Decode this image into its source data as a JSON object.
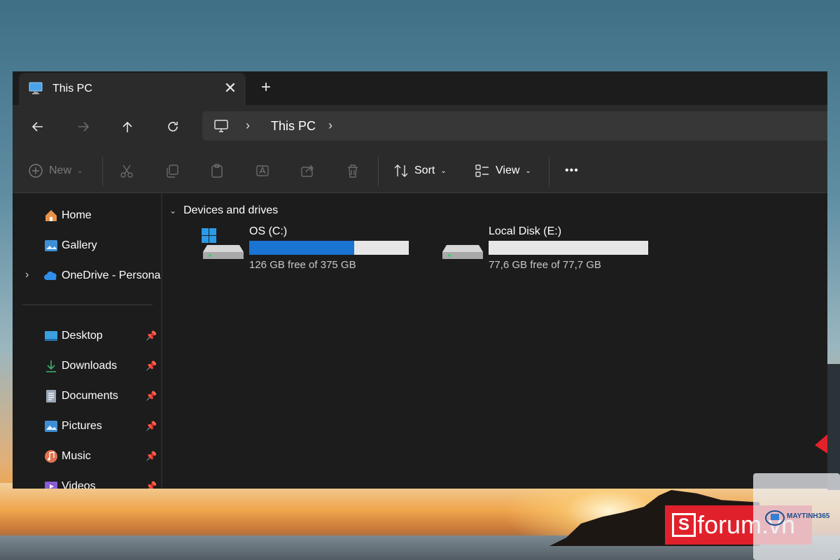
{
  "window": {
    "tab_title": "This PC",
    "tab_close": "✕",
    "new_tab": "+"
  },
  "navigation": {
    "breadcrumb": [
      "This PC"
    ]
  },
  "toolbar": {
    "new_label": "New",
    "sort_label": "Sort",
    "view_label": "View",
    "more_label": "•••"
  },
  "sidebar": {
    "quick": [
      {
        "label": "Home",
        "icon": "home-icon"
      },
      {
        "label": "Gallery",
        "icon": "gallery-icon"
      },
      {
        "label": "OneDrive - Persona",
        "icon": "onedrive-icon"
      }
    ],
    "pinned": [
      {
        "label": "Desktop",
        "icon": "desktop-icon"
      },
      {
        "label": "Downloads",
        "icon": "downloads-icon"
      },
      {
        "label": "Documents",
        "icon": "documents-icon"
      },
      {
        "label": "Pictures",
        "icon": "pictures-icon"
      },
      {
        "label": "Music",
        "icon": "music-icon"
      },
      {
        "label": "Videos",
        "icon": "videos-icon"
      }
    ]
  },
  "content": {
    "group_label": "Devices and drives",
    "drives": [
      {
        "name": "OS (C:)",
        "free_text": "126 GB free of 375 GB",
        "used_fraction": 0.66,
        "bar_color": "#1a74d1"
      },
      {
        "name": "Local Disk (E:)",
        "free_text": "77,6 GB free of 77,7 GB",
        "used_fraction": 0.0,
        "bar_color": "#1a74d1"
      }
    ]
  },
  "watermarks": {
    "sforum": "forum.vn",
    "sforum_s": "S",
    "maytinh": "MAYTINH365"
  },
  "colors": {
    "accent": "#1a74d1",
    "arrow": "#e0212b",
    "window_bg": "#1c1c1c"
  }
}
